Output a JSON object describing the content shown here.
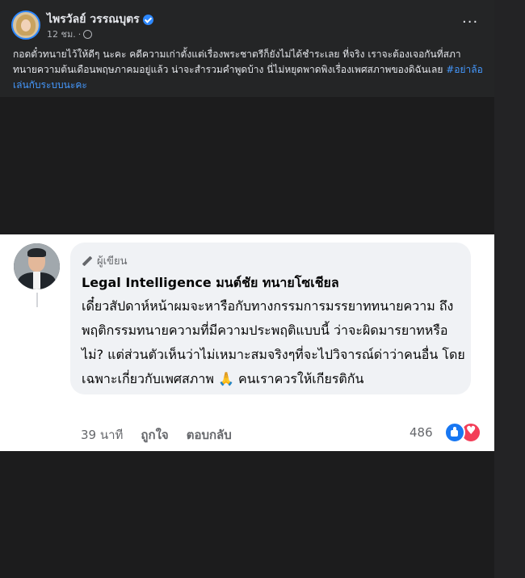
{
  "post": {
    "author": "ไพรวัลย์ วรรณบุตร",
    "time": "12 ชม.",
    "more": "···",
    "text": "กอดตั๋วทนายไว้ให้ดีๆ นะคะ คดีความเก่าตั้งแต่เรื่องพระชาตรีก็ยังไม่ได้ชำระเลย ที่จริง เราจะต้องเจอกันที่สภาทนายความต้นเดือนพฤษภาคมอยู่แล้ว น่าจะสำรวมคำพูดบ้าง นี่ไม่หยุดพาดพิงเรื่องเพศสภาพของดิฉันเลย ",
    "hashtag": "#อย่าล้อเล่นกับระบบนะคะ"
  },
  "comment": {
    "badge": "ผู้เขียน",
    "name": "Legal Intelligence มนต์ชัย ทนายโซเชียล",
    "text": "เดี๋ยวสัปดาห์หน้าผมจะหารือกับทางกรรมการมรรยาททนายความ ถึงพฤติกรรมทนายความที่มีความประพฤติแบบนี้ ว่าจะผิดมารยาทหรือไม่? แต่ส่วนตัวเห็นว่าไม่เหมาะสมจริงๆที่จะไปวิจารณ์ด่าว่าคนอื่น โดยเฉพาะเกี่ยวกับเพศสภาพ 🙏 คนเราควรให้เกียรติกัน",
    "time": "39 นาที",
    "like_label": "ถูกใจ",
    "reply_label": "ตอบกลับ",
    "reaction_count": "486"
  },
  "colors": {
    "accent": "#2d88ff",
    "like": "#1877f2",
    "love": "#f33e58"
  }
}
